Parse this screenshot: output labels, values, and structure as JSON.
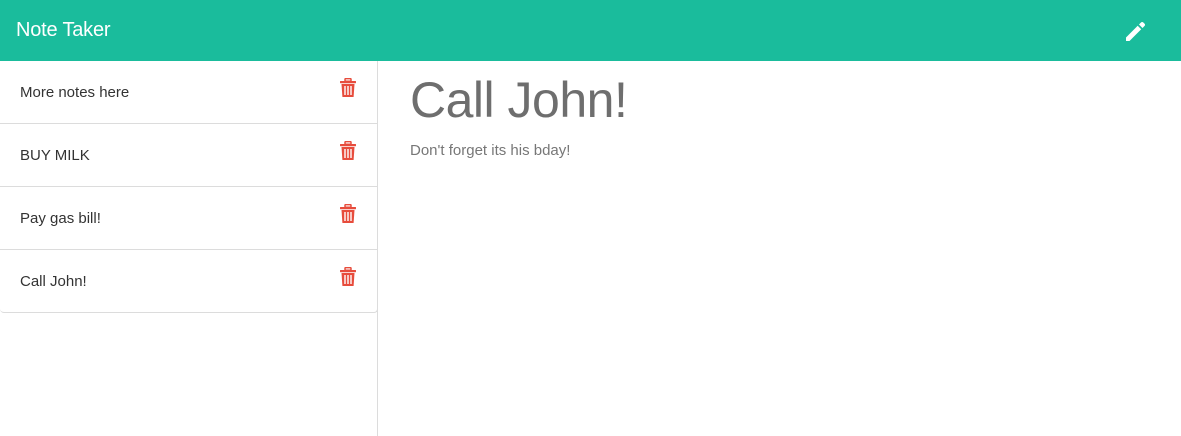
{
  "app": {
    "brand": "Note Taker"
  },
  "colors": {
    "navbar": "#1abc9c",
    "trash": "#e74c3c"
  },
  "header": {
    "new_note_icon": "pencil-icon"
  },
  "notes": [
    {
      "title": "More notes here",
      "icon": "trash-icon"
    },
    {
      "title": "BUY MILK",
      "icon": "trash-icon"
    },
    {
      "title": "Pay gas bill!",
      "icon": "trash-icon"
    },
    {
      "title": "Call John!",
      "icon": "trash-icon"
    }
  ],
  "active_note": {
    "title": "Call John!",
    "text": "Don't forget its his bday!"
  }
}
